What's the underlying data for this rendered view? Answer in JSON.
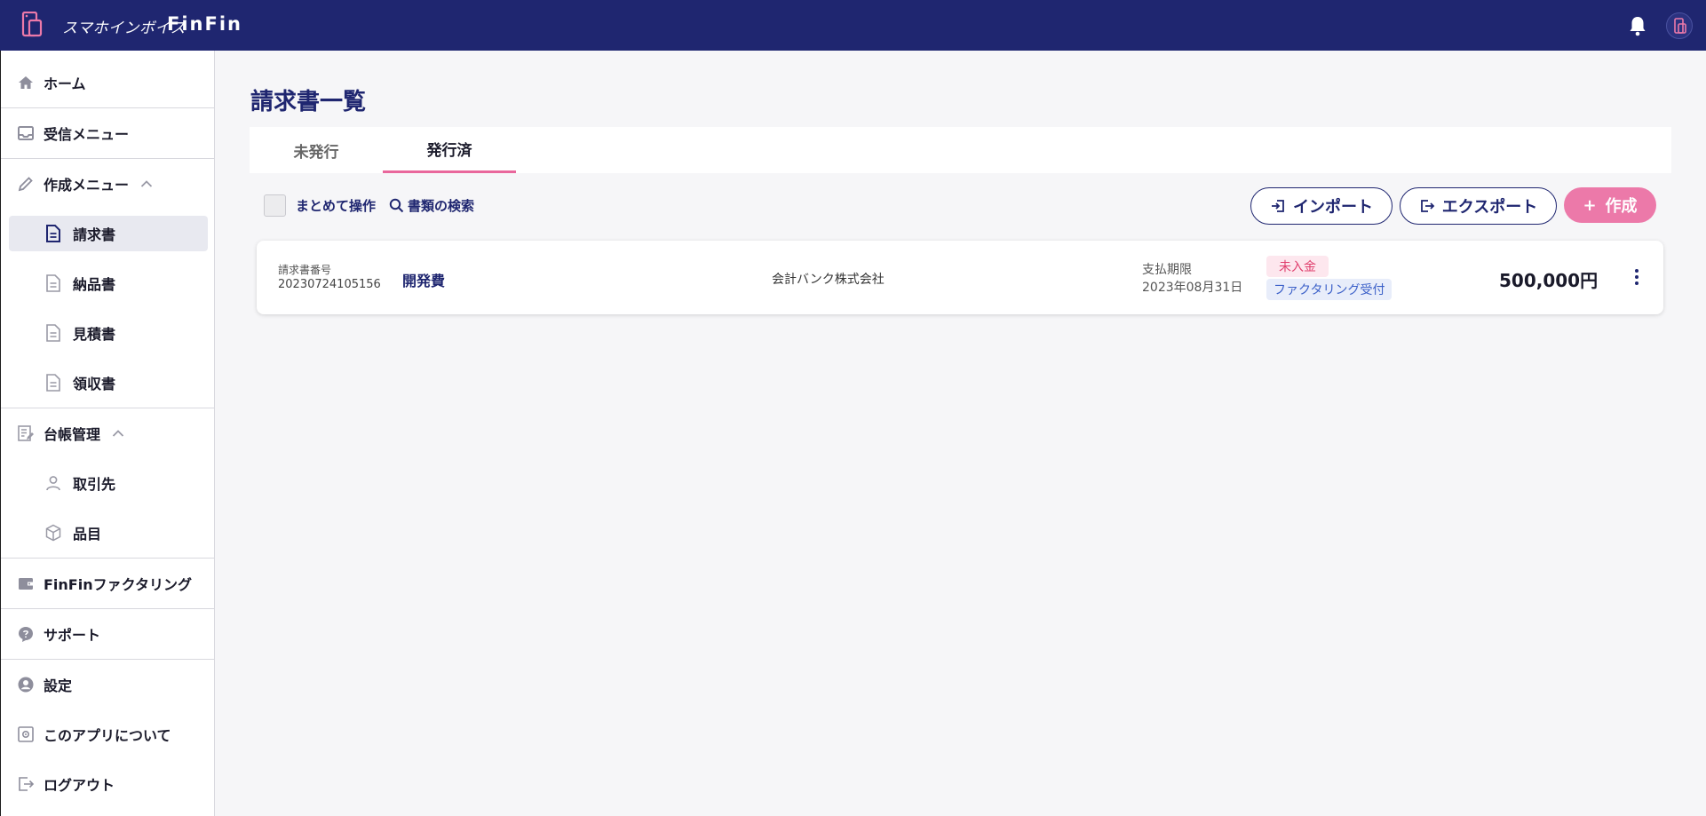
{
  "header": {
    "brand_jp": "スマホインボイス",
    "brand_en": "FinFin"
  },
  "sidebar": {
    "home": "ホーム",
    "inbox": "受信メニュー",
    "create_menu": "作成メニュー",
    "create_items": [
      "請求書",
      "納品書",
      "見積書",
      "領収書"
    ],
    "ledger": "台帳管理",
    "ledger_items": [
      "取引先",
      "品目"
    ],
    "factoring": "FinFinファクタリング",
    "support": "サポート",
    "settings": "設定",
    "about": "このアプリについて",
    "logout": "ログアウト"
  },
  "main": {
    "title": "請求書一覧",
    "tabs": [
      "未発行",
      "発行済"
    ],
    "bulk_label": "まとめて操作",
    "search_label": "書類の検索",
    "import_label": "インポート",
    "export_label": "エクスポート",
    "create_label": "作成"
  },
  "invoice": {
    "number_label": "請求書番号",
    "number": "20230724105156",
    "subject": "開発費",
    "client": "会計バンク株式会社",
    "due_label": "支払期限",
    "due_date": "2023年08月31日",
    "status": "未入金",
    "factoring_badge": "ファクタリング受付",
    "amount": "500,000円"
  },
  "colors": {
    "header_bg": "#1f2670",
    "accent_pink": "#ec79a9",
    "navy_text": "#1f2670"
  }
}
